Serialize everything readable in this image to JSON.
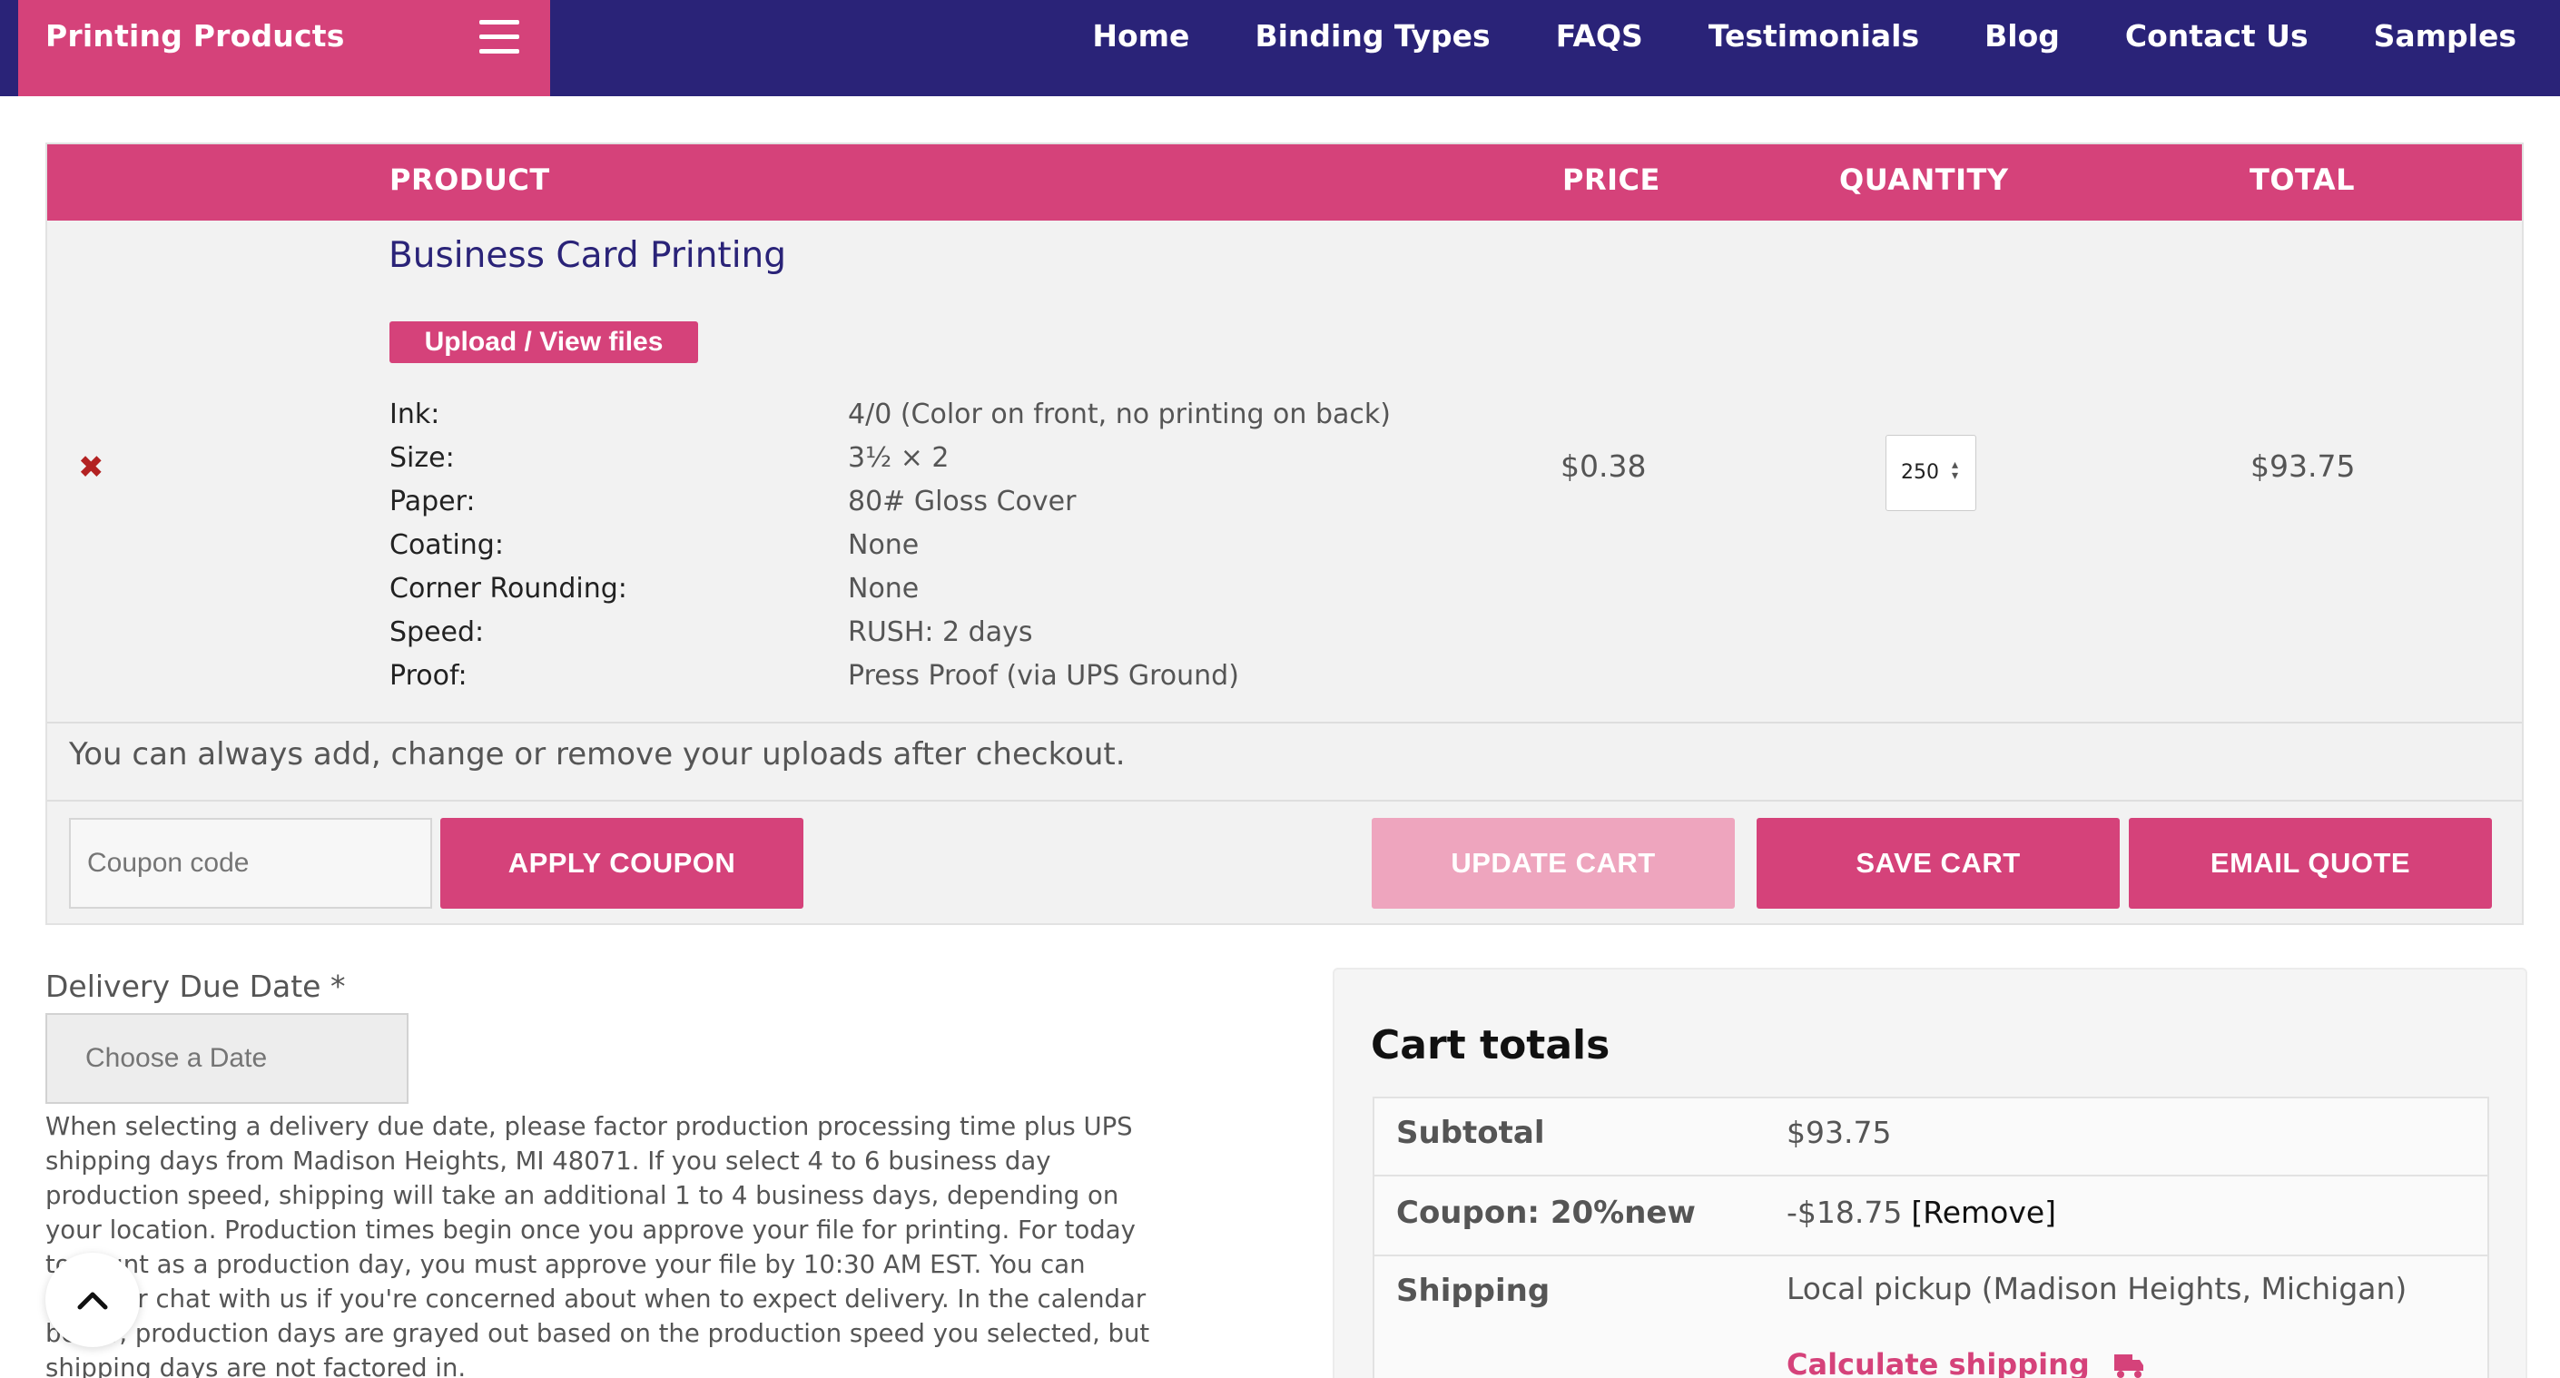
{
  "header": {
    "brand": "Printing Products",
    "nav": [
      "Home",
      "Binding Types",
      "FAQS",
      "Testimonials",
      "Blog",
      "Contact Us",
      "Samples"
    ]
  },
  "cart": {
    "columns": {
      "product": "PRODUCT",
      "price": "PRICE",
      "quantity": "QUANTITY",
      "total": "TOTAL"
    },
    "item": {
      "name": "Business Card Printing",
      "upload_label": "Upload / View files",
      "options": [
        {
          "label": "Ink:",
          "value": "4/0 (Color on front, no printing on back)"
        },
        {
          "label": "Size:",
          "value": "3½ × 2"
        },
        {
          "label": "Paper:",
          "value": "80# Gloss Cover"
        },
        {
          "label": "Coating:",
          "value": "None"
        },
        {
          "label": "Corner Rounding:",
          "value": "None"
        },
        {
          "label": "Speed:",
          "value": "RUSH: 2 days"
        },
        {
          "label": "Proof:",
          "value": "Press Proof (via UPS Ground)"
        }
      ],
      "price": "$0.38",
      "quantity": "250",
      "total": "$93.75",
      "remove_glyph": "✖"
    },
    "uploads_note": "You can always add, change or remove your uploads after checkout.",
    "coupon_placeholder": "Coupon code",
    "buttons": {
      "apply_coupon": "APPLY COUPON",
      "update_cart": "UPDATE CART",
      "save_cart": "SAVE CART",
      "email_quote": "EMAIL QUOTE"
    }
  },
  "delivery": {
    "label": "Delivery Due Date *",
    "date_placeholder": "Choose a Date",
    "help_text": "When selecting a delivery due date, please factor production processing time plus UPS shipping days from Madison Heights, MI 48071. If you select 4 to 6 business day production speed, shipping will take an additional 1 to 4 business days, depending on your location. Production times begin once you approve your file for printing. For today to count as a production day, you must approve your file by 10:30 AM EST. You can email or chat with us if you're concerned about when to expect delivery. In the calendar below, production days are grayed out based on the production speed you selected, but shipping days are not factored in."
  },
  "totals": {
    "title": "Cart totals",
    "subtotal_label": "Subtotal",
    "subtotal_value": "$93.75",
    "coupon_label": "Coupon: 20%new",
    "coupon_value": "-$18.75",
    "coupon_remove": "[Remove]",
    "shipping_label": "Shipping",
    "shipping_value": "Local pickup (Madison Heights, Michigan)",
    "calc_shipping": "Calculate shipping"
  },
  "colors": {
    "brand_pink": "#d5427a",
    "nav_navy": "#2a2378",
    "disabled_pink": "#eea5be"
  }
}
